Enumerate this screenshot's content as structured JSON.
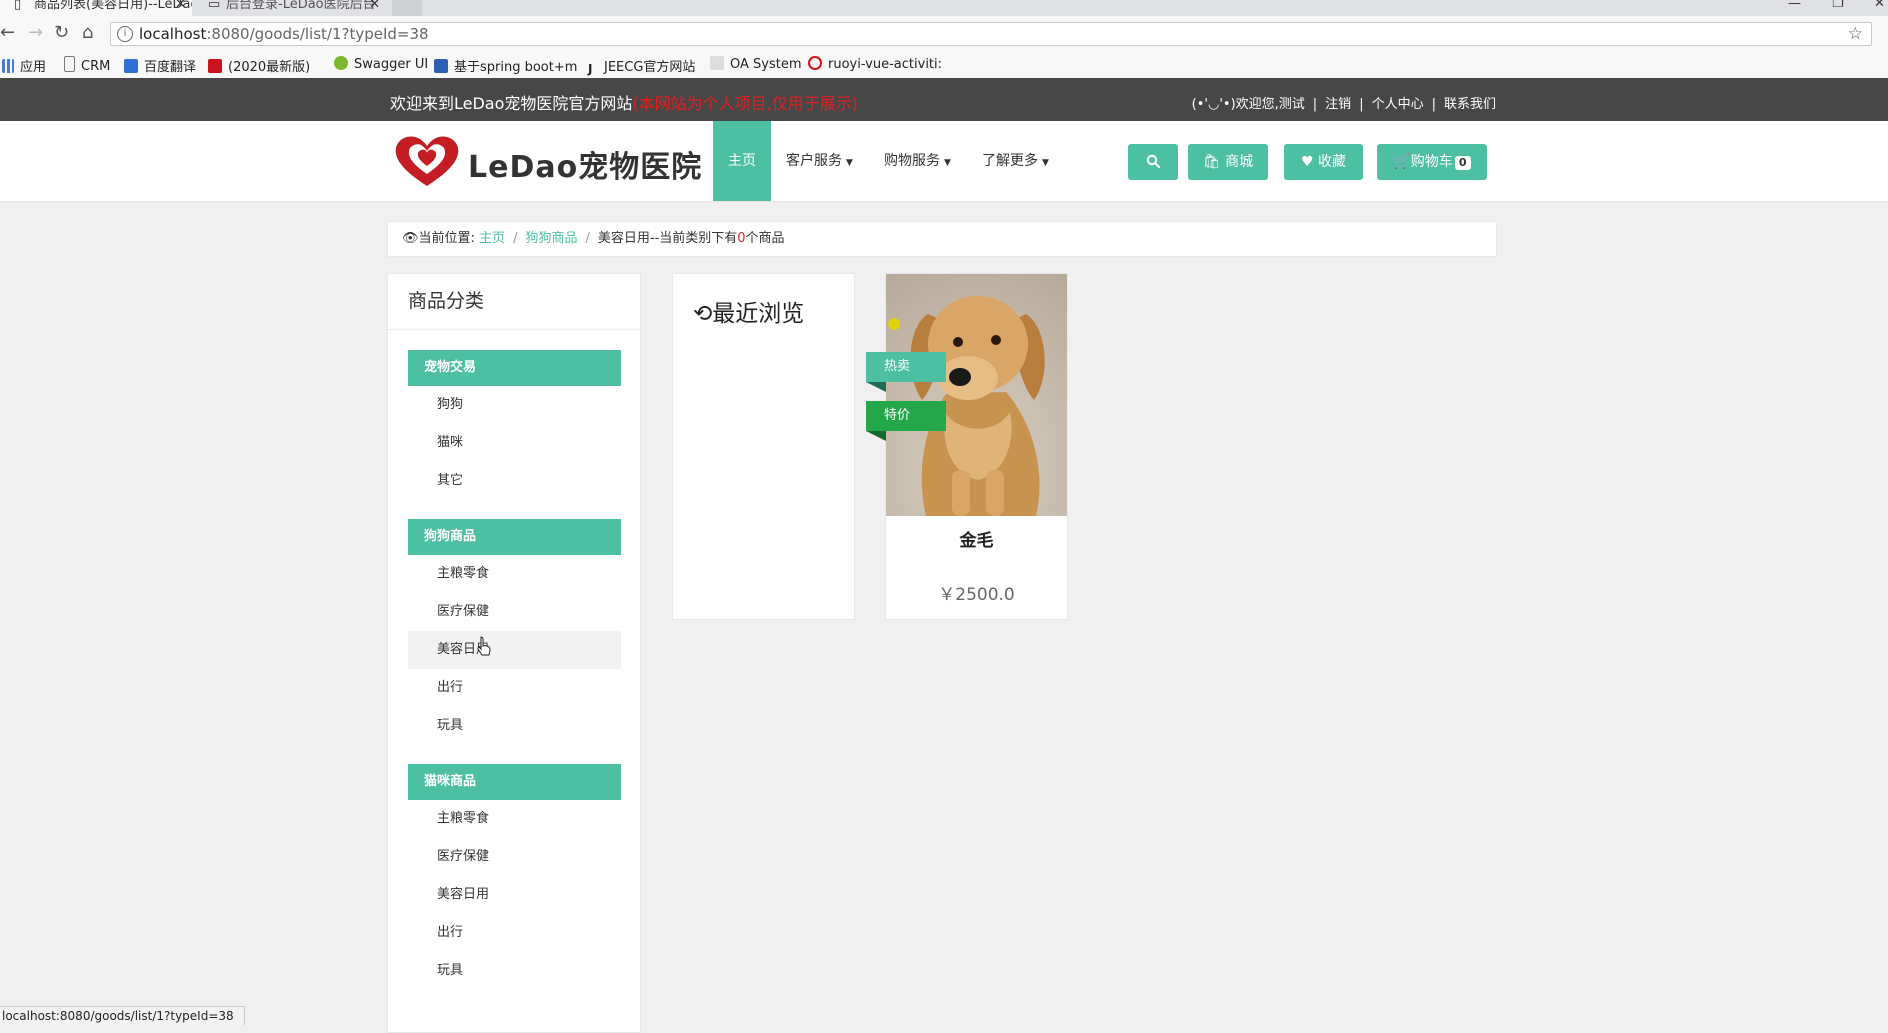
{
  "browser": {
    "tabs": [
      {
        "label": "商品列表(美容日用)--LeDao",
        "active": true
      },
      {
        "label": "后台登录-LeDao医院后台",
        "active": false
      }
    ],
    "url_host": "localhost",
    "url_rest": ":8080/goods/list/1?typeId=38",
    "bookmarks": [
      "应用",
      "CRM",
      "百度翻译",
      "(2020最新版)",
      "Swagger UI",
      "基于spring boot+m",
      "JEECG官方网站",
      "OA System",
      "ruoyi-vue-activiti:"
    ],
    "status_url": "localhost:8080/goods/list/1?typeId=38"
  },
  "topbar": {
    "welcome": "欢迎来到LeDao宠物医院官方网站",
    "notice": "(本网站为个人项目,仅用于展示)",
    "user_greeting": "(•'◡'•)欢迎您,测试",
    "logout": "注销",
    "profile": "个人中心",
    "contact": "联系我们"
  },
  "header": {
    "logo_text": "LeDao宠物医院",
    "nav": [
      {
        "label": "主页",
        "dropdown": false
      },
      {
        "label": "客户服务",
        "dropdown": true
      },
      {
        "label": "购物服务",
        "dropdown": true
      },
      {
        "label": "了解更多",
        "dropdown": true
      }
    ],
    "mall_label": "商城",
    "favorite_label": "收藏",
    "cart_label": "购物车",
    "cart_count": "0"
  },
  "breadcrumb": {
    "prefix": "当前位置:",
    "home": "主页",
    "category": "狗狗商品",
    "current": "美容日用",
    "count_prefix": "--当前类别下有",
    "count": "0",
    "count_suffix": "个商品"
  },
  "sidebar": {
    "title": "商品分类",
    "groups": [
      {
        "title": "宠物交易",
        "items": [
          "狗狗",
          "猫咪",
          "其它"
        ]
      },
      {
        "title": "狗狗商品",
        "items": [
          "主粮零食",
          "医疗保健",
          "美容日用",
          "出行",
          "玩具"
        ]
      },
      {
        "title": "猫咪商品",
        "items": [
          "主粮零食",
          "医疗保健",
          "美容日用",
          "出行",
          "玩具"
        ]
      }
    ]
  },
  "recent": {
    "title": "最近浏览"
  },
  "product": {
    "name": "金毛",
    "price": "￥2500.0",
    "tags": [
      "热卖",
      "特价"
    ]
  },
  "colors": {
    "accent": "#4dbfa2",
    "topbar_bg": "#474747",
    "notice_red": "#e02020",
    "sale_tag": "#26a64a"
  }
}
